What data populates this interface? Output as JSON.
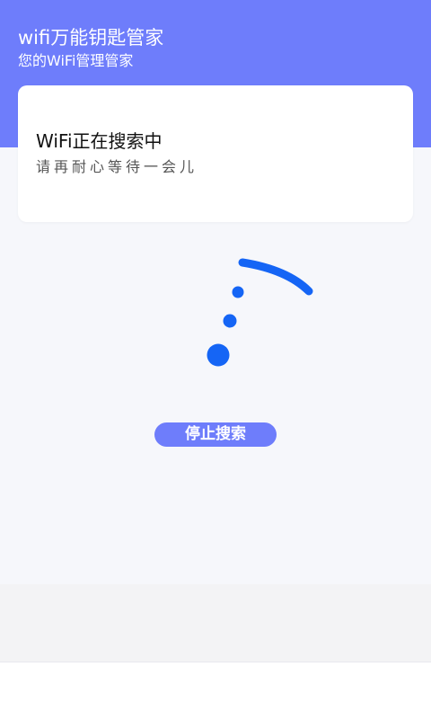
{
  "header": {
    "title": "wifi万能钥匙管家",
    "subtitle": "您的WiFi管理管家"
  },
  "card": {
    "title": "WiFi正在搜索中",
    "subtitle": "请再耐心等待一会儿"
  },
  "actions": {
    "stop_label": "停止搜索"
  },
  "colors": {
    "accent": "#6e7dfb",
    "spinner": "#1565f5"
  },
  "icons": {
    "spinner": "loading-spinner-icon"
  }
}
